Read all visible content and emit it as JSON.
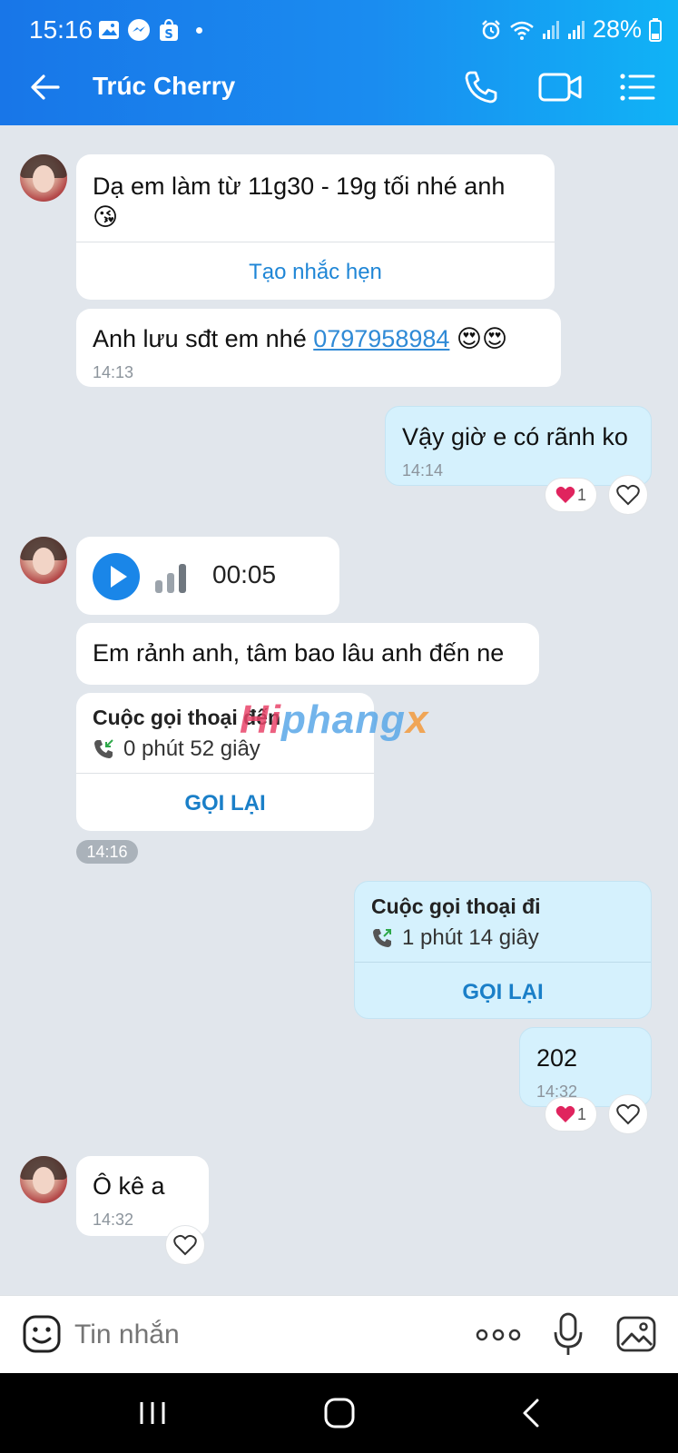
{
  "status_bar": {
    "time": "15:16",
    "battery": "28%"
  },
  "app_bar": {
    "contact_name": "Trúc Cherry"
  },
  "messages": {
    "m1": {
      "text": "Dạ em làm từ 11g30 - 19g tối nhé anh",
      "emoji": "😘",
      "action": "Tạo nhắc hẹn"
    },
    "m2": {
      "text_before": "Anh lưu sđt em nhé ",
      "phone": "0797958984",
      "emoji": "😍😍",
      "time": "14:13"
    },
    "m3": {
      "text": "Vậy giờ e có rãnh ko",
      "time": "14:14",
      "reaction_count": "1"
    },
    "m4": {
      "voice_duration": "00:05"
    },
    "m5": {
      "text": "Em rảnh anh, tâm bao lâu anh đến ne"
    },
    "m6": {
      "title": "Cuộc gọi thoại đến",
      "duration": "0 phút 52 giây",
      "action": "GỌI LẠI"
    },
    "time_chip": "14:16",
    "m7": {
      "title": "Cuộc gọi thoại đi",
      "duration": "1 phút 14 giây",
      "action": "GỌI LẠI"
    },
    "m8": {
      "text": "202",
      "time": "14:32",
      "reaction_count": "1"
    },
    "m9": {
      "text": "Ô kê a",
      "time": "14:32"
    }
  },
  "watermark": {
    "part1": "Hi",
    "part2": "phang",
    "part3": "x"
  },
  "composer": {
    "placeholder": "Tin nhắn"
  },
  "colors": {
    "brand_blue": "#1a8cf0",
    "outgoing_bubble": "#d5f1fd",
    "link": "#2f8ad6",
    "heart": "#e0245e"
  }
}
